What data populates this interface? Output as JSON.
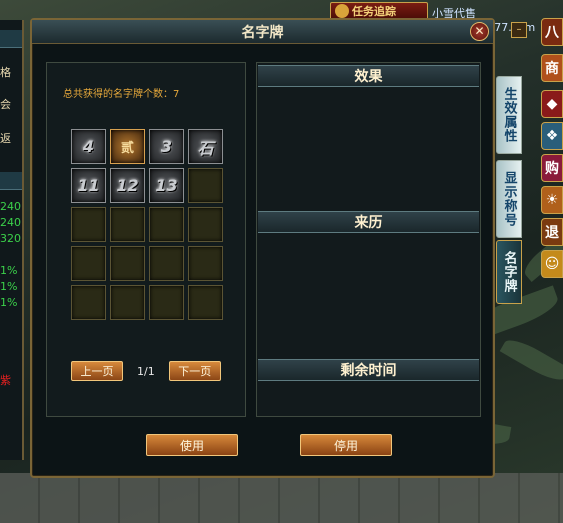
{
  "header": {
    "quest_track": "任务追踪",
    "watermark": "小雪代售www.xxds777.com"
  },
  "left_panel": {
    "rows": [
      "格",
      "会",
      "返",
      "240",
      "240",
      "320",
      "1%",
      "1%",
      "1%",
      "紫"
    ]
  },
  "window": {
    "title": "名字牌",
    "close_label": "✕",
    "count_label": "总共获得的名字牌个数：7",
    "slots": [
      {
        "text": "4",
        "style": "filled"
      },
      {
        "text": "贰",
        "style": "gold"
      },
      {
        "text": "3",
        "style": "filled"
      },
      {
        "text": "石",
        "style": "filled"
      },
      {
        "text": "11",
        "style": "filled"
      },
      {
        "text": "12",
        "style": "filled"
      },
      {
        "text": "13",
        "style": "filled"
      },
      {
        "text": "",
        "style": "empty"
      },
      {
        "text": "",
        "style": "empty"
      },
      {
        "text": "",
        "style": "empty"
      },
      {
        "text": "",
        "style": "empty"
      },
      {
        "text": "",
        "style": "empty"
      },
      {
        "text": "",
        "style": "empty"
      },
      {
        "text": "",
        "style": "empty"
      },
      {
        "text": "",
        "style": "empty"
      },
      {
        "text": "",
        "style": "empty"
      },
      {
        "text": "",
        "style": "empty"
      },
      {
        "text": "",
        "style": "empty"
      },
      {
        "text": "",
        "style": "empty"
      },
      {
        "text": "",
        "style": "empty"
      }
    ],
    "prev_page": "上一页",
    "next_page": "下一页",
    "page_indicator": "1/1",
    "sections": {
      "effect": "效果",
      "origin": "来历",
      "remaining_time": "剩余时间"
    },
    "use_button": "使用",
    "disable_button": "停用"
  },
  "side_tabs": [
    {
      "label": "生效属性",
      "active": false
    },
    {
      "label": "显示称号",
      "active": false
    },
    {
      "label": "名字牌",
      "active": true
    }
  ],
  "min_button": "–",
  "skillbar": [
    {
      "label": "八",
      "color": "#7a2a10"
    },
    {
      "label": "商",
      "color": "#b0501b"
    },
    {
      "label": "◆",
      "color": "#8a1a1a"
    },
    {
      "label": "❖",
      "color": "#2a5e7a"
    },
    {
      "label": "购",
      "color": "#8a1a3a"
    },
    {
      "label": "☀",
      "color": "#b0601b"
    },
    {
      "label": "退",
      "color": "#7a3a10"
    },
    {
      "label": "☺",
      "color": "#c48a1b"
    }
  ]
}
